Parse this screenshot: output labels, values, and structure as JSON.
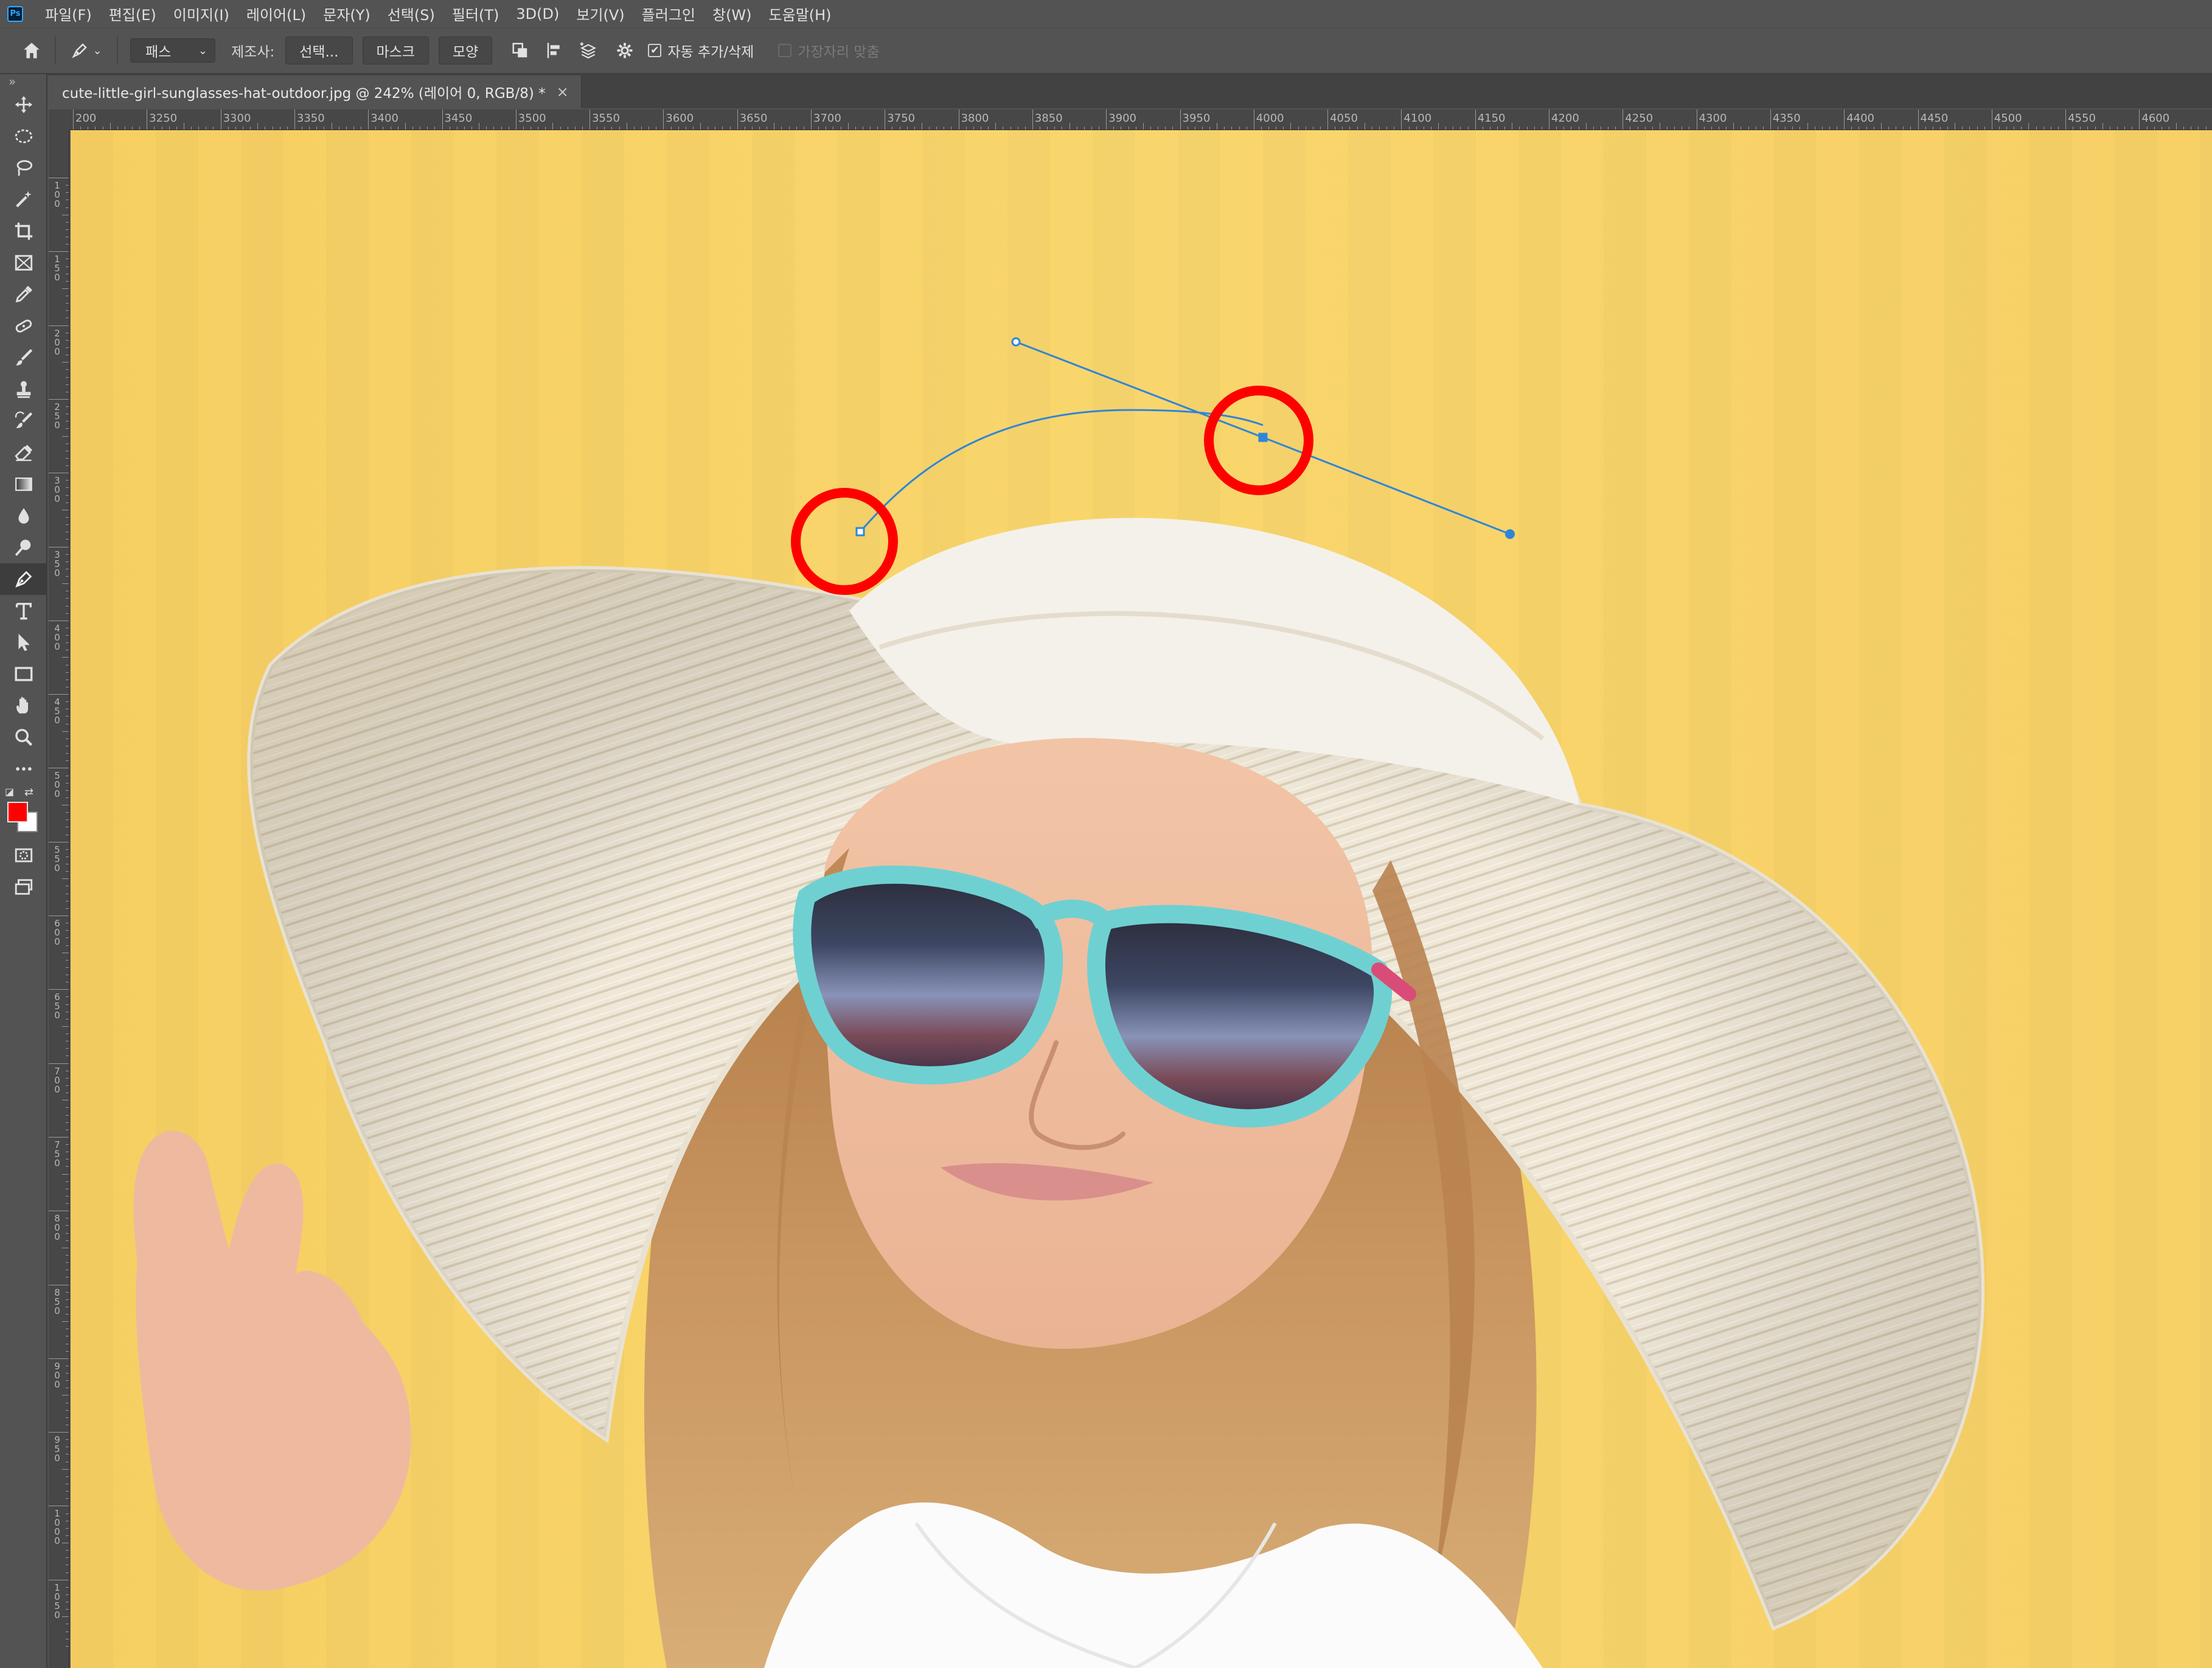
{
  "app": {
    "logo": "Ps"
  },
  "menu": [
    "파일(F)",
    "편집(E)",
    "이미지(I)",
    "레이어(L)",
    "문자(Y)",
    "선택(S)",
    "필터(T)",
    "3D(D)",
    "보기(V)",
    "플러그인",
    "창(W)",
    "도움말(H)"
  ],
  "options": {
    "mode_value": "패스",
    "make_label": "제조사:",
    "selection_button": "선택...",
    "mask_button": "마스크",
    "shape_button": "모양",
    "auto_add_delete_label": "자동 추가/삭제",
    "auto_add_delete_checked": true,
    "align_edges_label": "가장자리 맞춤",
    "align_edges_checked": false
  },
  "document": {
    "tab_title": "cute-little-girl-sunglasses-hat-outdoor.jpg @ 242% (레이어 0, RGB/8) *",
    "close_icon": "×"
  },
  "rulers": {
    "horizontal": [
      "200",
      "3250",
      "3300",
      "3350",
      "3400",
      "3450",
      "3500",
      "3550",
      "3600",
      "3650",
      "3700",
      "3750",
      "3800",
      "3850",
      "3900",
      "3950",
      "4000",
      "4050",
      "4100",
      "4150",
      "4200",
      "4250",
      "4300",
      "4350",
      "4400",
      "4450",
      "4500",
      "4550",
      "4600",
      "46"
    ],
    "vertical": [
      "100",
      "150",
      "200",
      "250",
      "300",
      "350",
      "400",
      "450",
      "500",
      "550",
      "600",
      "650",
      "700",
      "750",
      "800",
      "850",
      "900",
      "950",
      "1000",
      "1050"
    ]
  },
  "colors": {
    "foreground": "#ff0000",
    "background": "#ffffff",
    "path": "#2f86d6",
    "highlight_circle": "#ff0000",
    "canvas_bg": "#f8d46a"
  },
  "tools": [
    "move-tool",
    "marquee-tool",
    "lasso-tool",
    "magic-wand-tool",
    "crop-tool",
    "frame-tool",
    "eyedropper-tool",
    "healing-brush-tool",
    "brush-tool",
    "clone-stamp-tool",
    "history-brush-tool",
    "eraser-tool",
    "gradient-tool",
    "blur-tool",
    "dodge-tool",
    "pen-tool",
    "type-tool",
    "path-selection-tool",
    "rectangle-tool",
    "hand-tool",
    "zoom-tool",
    "edit-toolbar"
  ],
  "active_tool": "pen-tool"
}
